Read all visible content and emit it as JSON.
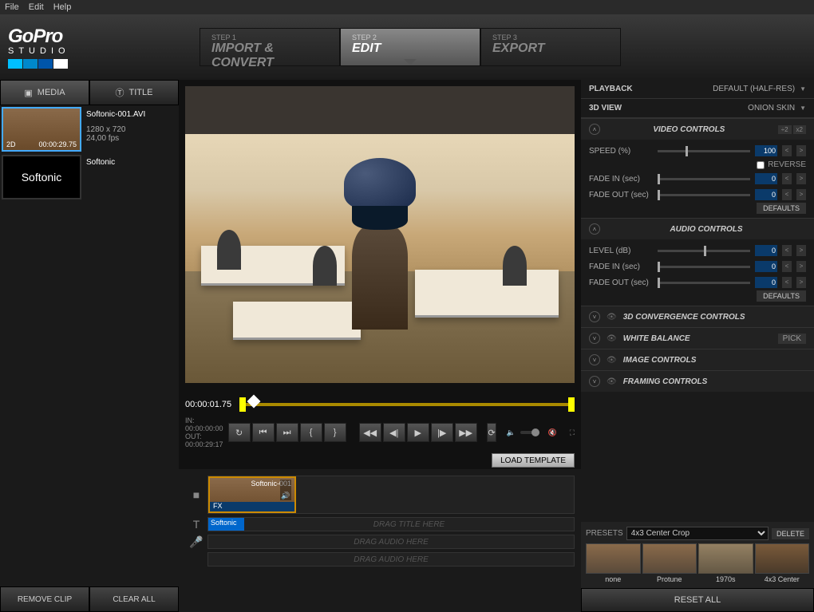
{
  "menu": {
    "file": "File",
    "edit": "Edit",
    "help": "Help"
  },
  "brand": {
    "name": "GoPro",
    "sub": "STUDIO",
    "colors": [
      "#00bfff",
      "#0088cc",
      "#0055aa",
      "#ffffff"
    ]
  },
  "steps": [
    {
      "n": "STEP 1",
      "t": "IMPORT & CONVERT"
    },
    {
      "n": "STEP 2",
      "t": "EDIT"
    },
    {
      "n": "STEP 3",
      "t": "EXPORT"
    }
  ],
  "leftTabs": {
    "media": "MEDIA",
    "title": "TITLE"
  },
  "clips": [
    {
      "file": "Softonic-001.AVI",
      "res": "1280 x 720",
      "fps": "24,00 fps",
      "badge2d": "2D",
      "dur": "00:00:29.75"
    },
    {
      "file": "Softonic",
      "titleText": "Softonic",
      "isTitle": true
    }
  ],
  "removeClip": "REMOVE CLIP",
  "clearAll": "CLEAR ALL",
  "playhead": "00:00:01.75",
  "inLabel": "IN:",
  "inVal": "00:00:00:00",
  "outLabel": "OUT:",
  "outVal": "00:00:29:17",
  "loadTemplate": "LOAD TEMPLATE",
  "timeline": {
    "clipLabel": "Softonic-001",
    "fx": "FX",
    "titleChip": "Softonic",
    "dragTitle": "DRAG TITLE HERE",
    "dragAudio1": "DRAG AUDIO HERE",
    "dragAudio2": "DRAG AUDIO HERE"
  },
  "right": {
    "playback": {
      "lbl": "PLAYBACK",
      "val": "DEFAULT (HALF-RES)"
    },
    "view3d": {
      "lbl": "3D VIEW",
      "val": "ONION SKIN"
    },
    "video": {
      "head": "VIDEO CONTROLS",
      "halves": [
        "÷2",
        "x2"
      ],
      "speedLbl": "SPEED (%)",
      "speedVal": "100",
      "reverse": "REVERSE",
      "fadeIn": "FADE IN (sec)",
      "fadeInVal": "0",
      "fadeOut": "FADE OUT (sec)",
      "fadeOutVal": "0",
      "defaults": "DEFAULTS"
    },
    "audio": {
      "head": "AUDIO CONTROLS",
      "level": "LEVEL (dB)",
      "levelVal": "0",
      "fadeIn": "FADE IN (sec)",
      "fadeInVal": "0",
      "fadeOut": "FADE OUT (sec)",
      "fadeOutVal": "0",
      "defaults": "DEFAULTS"
    },
    "conv3d": "3D CONVERGENCE CONTROLS",
    "wb": "WHITE BALANCE",
    "pick": "PICK",
    "img": "IMAGE CONTROLS",
    "framing": "FRAMING CONTROLS",
    "presetsLbl": "PRESETS",
    "presetSel": "4x3 Center Crop",
    "delete": "DELETE",
    "presets": [
      "none",
      "Protune",
      "1970s",
      "4x3 Center"
    ],
    "resetAll": "RESET ALL"
  }
}
